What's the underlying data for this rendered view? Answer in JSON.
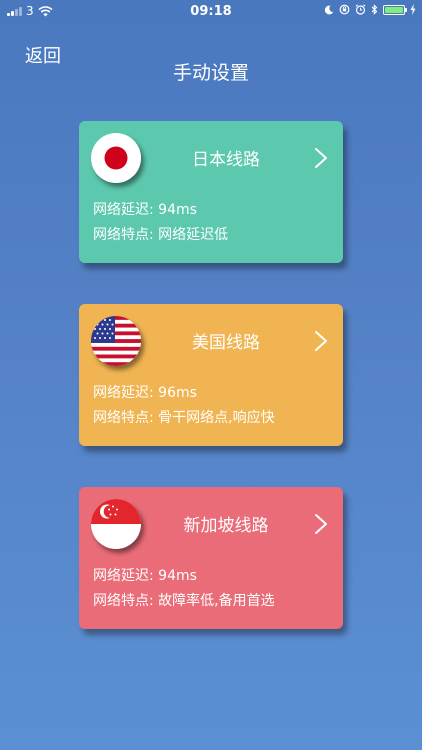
{
  "status_bar": {
    "carrier": "3",
    "time": "09:18"
  },
  "nav": {
    "back_label": "返回",
    "title": "手动设置"
  },
  "routes": [
    {
      "name": "日本线路",
      "flag_icon": "japan-flag-icon",
      "color": "#5cc8ae",
      "latency_label": "网络延迟:",
      "latency_value": "94ms",
      "feature_label": "网络特点:",
      "feature_value": "网络延迟低"
    },
    {
      "name": "美国线路",
      "flag_icon": "usa-flag-icon",
      "color": "#f0b452",
      "latency_label": "网络延迟:",
      "latency_value": "96ms",
      "feature_label": "网络特点:",
      "feature_value": "骨干网络点,响应快"
    },
    {
      "name": "新加坡线路",
      "flag_icon": "singapore-flag-icon",
      "color": "#ea6c78",
      "latency_label": "网络延迟:",
      "latency_value": "94ms",
      "feature_label": "网络特点:",
      "feature_value": "故障率低,备用首选"
    }
  ]
}
